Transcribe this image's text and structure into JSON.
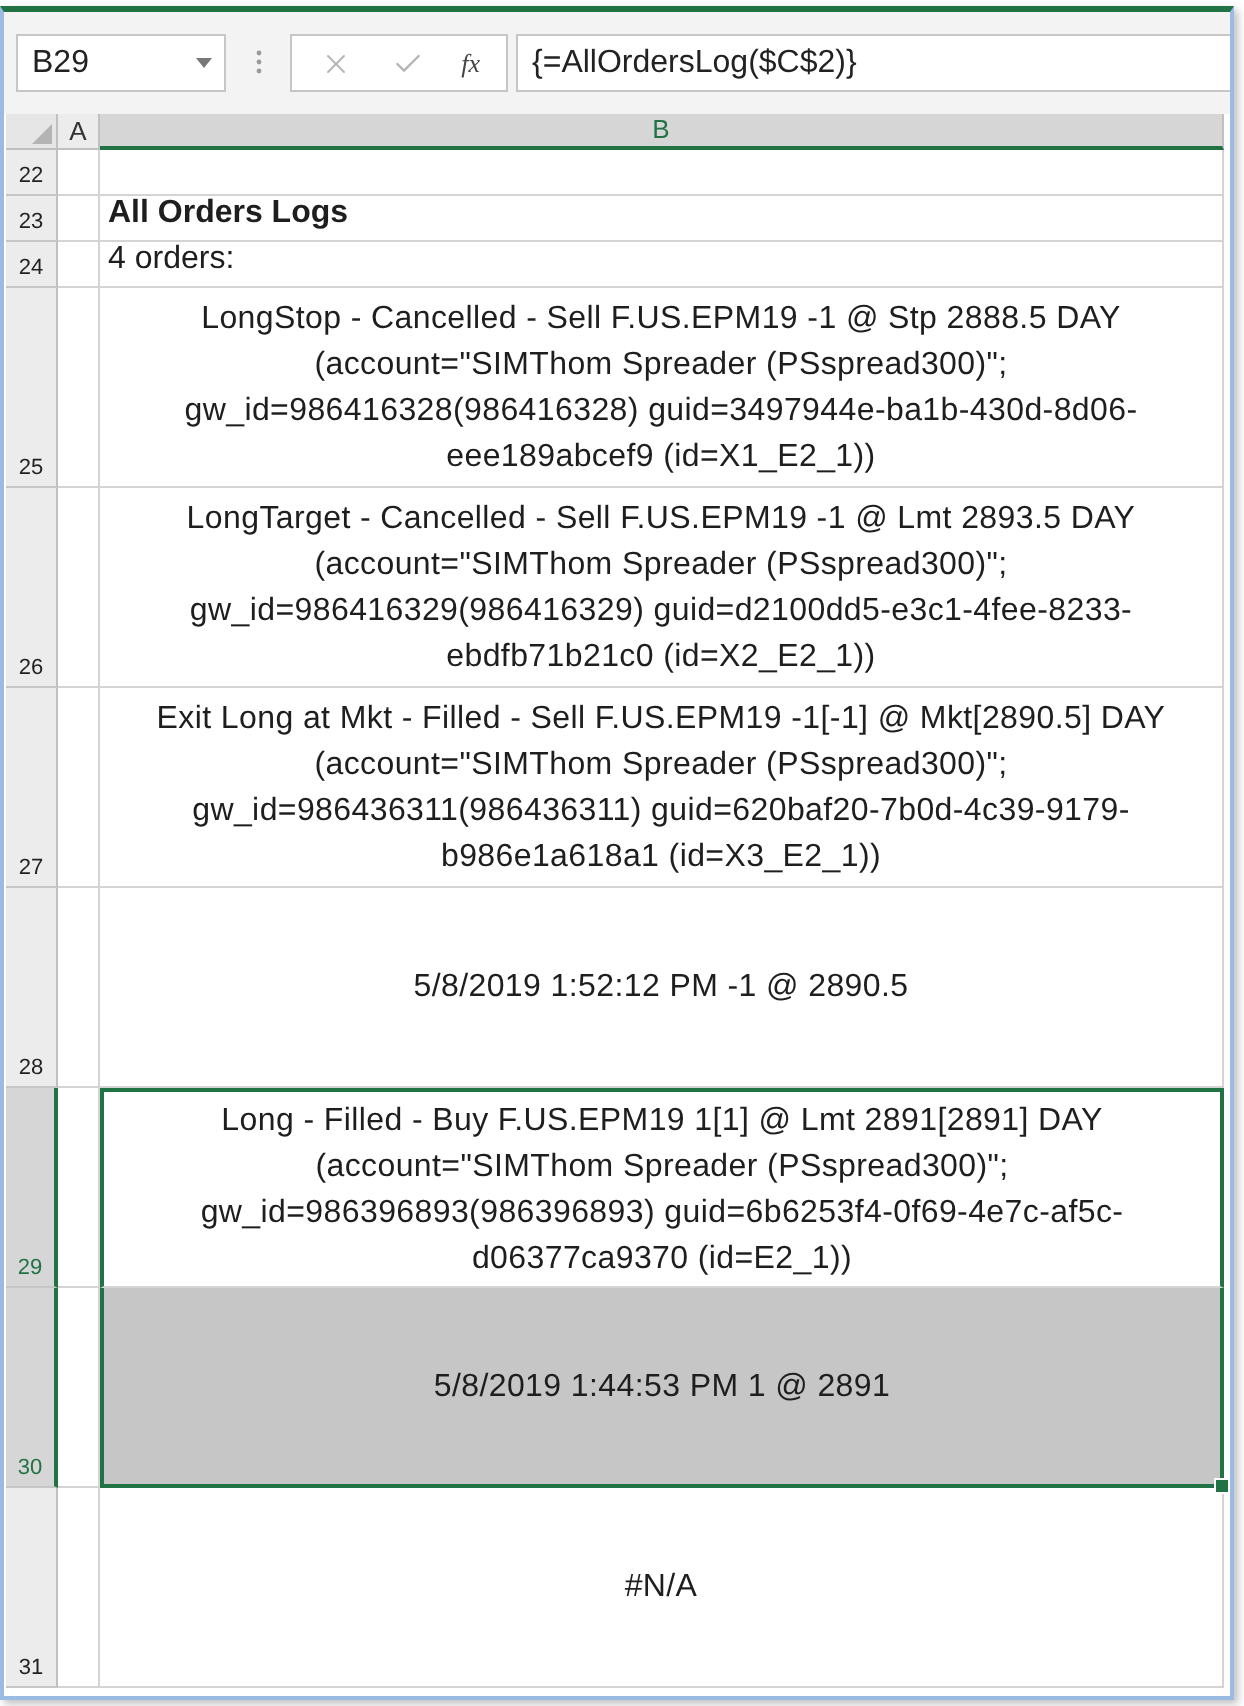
{
  "formula_bar": {
    "name_box": "B29",
    "cancel_button": {
      "disabled": true
    },
    "enter_button": {
      "disabled": true
    },
    "function_button": {
      "label": "fx"
    },
    "formula": "{=AllOrdersLog($C$2)}"
  },
  "columns": [
    {
      "label": "A",
      "selected": false
    },
    {
      "label": "B",
      "selected": true
    }
  ],
  "rows": [
    {
      "number": "22",
      "selected": false,
      "kind": "label"
    },
    {
      "number": "23",
      "selected": false,
      "kind": "label",
      "text": "All Orders Logs",
      "bold": true
    },
    {
      "number": "24",
      "selected": false,
      "kind": "label",
      "text": "4 orders:",
      "bold": false
    },
    {
      "number": "25",
      "selected": false,
      "kind": "wrapped",
      "lines": [
        "LongStop - Cancelled - Sell F.US.EPM19 -1 @ Stp 2888.5 DAY",
        "(account=\"SIMThom Spreader (PSspread300)\";",
        "gw_id=986416328(986416328) guid=3497944e-ba1b-430d-8d06-",
        "eee189abcef9 (id=X1_E2_1))"
      ]
    },
    {
      "number": "26",
      "selected": false,
      "kind": "wrapped",
      "lines": [
        "LongTarget - Cancelled - Sell F.US.EPM19 -1 @ Lmt 2893.5 DAY",
        "(account=\"SIMThom Spreader (PSspread300)\";",
        "gw_id=986416329(986416329) guid=d2100dd5-e3c1-4fee-8233-",
        "ebdfb71b21c0 (id=X2_E2_1))"
      ]
    },
    {
      "number": "27",
      "selected": false,
      "kind": "wrapped",
      "lines": [
        "Exit Long at Mkt - Filled - Sell F.US.EPM19 -1[-1] @ Mkt[2890.5] DAY",
        "(account=\"SIMThom Spreader (PSspread300)\";",
        "gw_id=986436311(986436311) guid=620baf20-7b0d-4c39-9179-",
        "b986e1a618a1 (id=X3_E2_1))"
      ]
    },
    {
      "number": "28",
      "selected": false,
      "kind": "wrapped",
      "lines": [
        "5/8/2019 1:52:12 PM -1 @ 2890.5"
      ]
    },
    {
      "number": "29",
      "selected": true,
      "active": true,
      "kind": "wrapped",
      "lines": [
        "Long - Filled - Buy F.US.EPM19 1[1] @ Lmt 2891[2891] DAY",
        "(account=\"SIMThom Spreader (PSspread300)\";",
        "gw_id=986396893(986396893) guid=6b6253f4-0f69-4e7c-af5c-",
        "d06377ca9370 (id=E2_1))"
      ]
    },
    {
      "number": "30",
      "selected": true,
      "active": false,
      "kind": "wrapped",
      "lines": [
        "5/8/2019 1:44:53 PM 1 @ 2891"
      ]
    },
    {
      "number": "31",
      "selected": false,
      "kind": "wrapped",
      "lines": [
        "#N/A"
      ]
    }
  ]
}
